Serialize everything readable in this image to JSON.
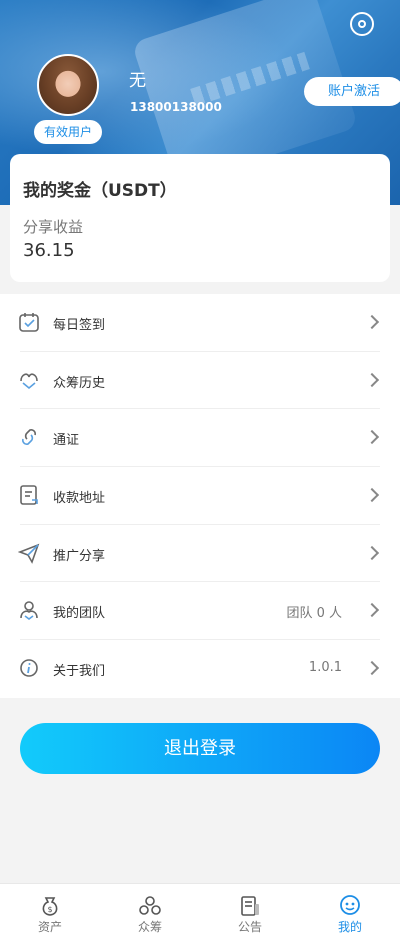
{
  "profile": {
    "nickname": "无",
    "phone": "13800138000",
    "status_badge": "有效用户",
    "activate_label": "账户激活"
  },
  "bonus": {
    "title": "我的奖金（USDT）",
    "label": "分享收益",
    "value": "36.15"
  },
  "menu": {
    "items": [
      {
        "label": "每日签到",
        "icon": "calendar-check-icon"
      },
      {
        "label": "众筹历史",
        "icon": "handshake-icon"
      },
      {
        "label": "通证",
        "icon": "link-icon"
      },
      {
        "label": "收款地址",
        "icon": "document-icon"
      },
      {
        "label": "推广分享",
        "icon": "paper-plane-icon"
      },
      {
        "label": "我的团队",
        "icon": "team-icon",
        "value": "团队 0 人"
      },
      {
        "label": "关于我们",
        "icon": "info-icon",
        "value": "1.0.1"
      }
    ]
  },
  "logout_label": "退出登录",
  "tabs": [
    {
      "label": "资产",
      "icon": "money-bag-icon",
      "active": false
    },
    {
      "label": "众筹",
      "icon": "crowdfunding-icon",
      "active": false
    },
    {
      "label": "公告",
      "icon": "announcement-icon",
      "active": false
    },
    {
      "label": "我的",
      "icon": "profile-icon",
      "active": true
    }
  ],
  "colors": {
    "accent": "#1d8ee6",
    "logout_gradient_start": "#12cbfb",
    "logout_gradient_end": "#0b86f5"
  }
}
